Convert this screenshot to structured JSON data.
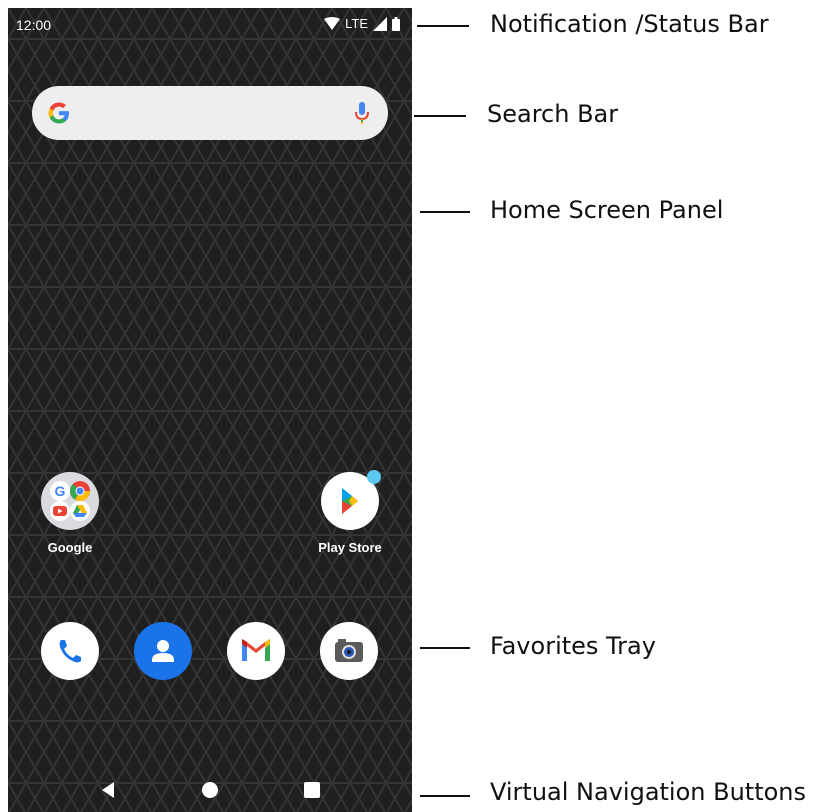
{
  "status_bar": {
    "time": "12:00",
    "network": "LTE",
    "icons": [
      "wifi-icon",
      "signal-icon",
      "battery-icon"
    ]
  },
  "search_bar": {
    "icons": [
      "google-g-icon",
      "microphone-icon"
    ]
  },
  "home_apps": [
    {
      "label": "Google",
      "icon": "google-folder-icon"
    },
    {
      "label": "Play Store",
      "icon": "play-store-icon"
    }
  ],
  "favorites": [
    {
      "icon": "phone-icon"
    },
    {
      "icon": "contacts-icon"
    },
    {
      "icon": "gmail-icon"
    },
    {
      "icon": "camera-icon"
    }
  ],
  "nav_buttons": [
    "back-icon",
    "home-icon",
    "recents-icon"
  ],
  "annotations": {
    "status_bar": "Notification /Status Bar",
    "search_bar": "Search Bar",
    "home_panel": "Home Screen Panel",
    "favorites_tray": "Favorites Tray",
    "nav_buttons": "Virtual Navigation Buttons"
  },
  "colors": {
    "wallpaper": "#1f1f1f",
    "search_bar": "#eeeeee",
    "google_blue": "#4285F4",
    "google_red": "#EA4335",
    "google_yellow": "#FBBC05",
    "google_green": "#34A853",
    "contacts_blue": "#1a73e8",
    "notification_dot": "#5bc8f0"
  }
}
